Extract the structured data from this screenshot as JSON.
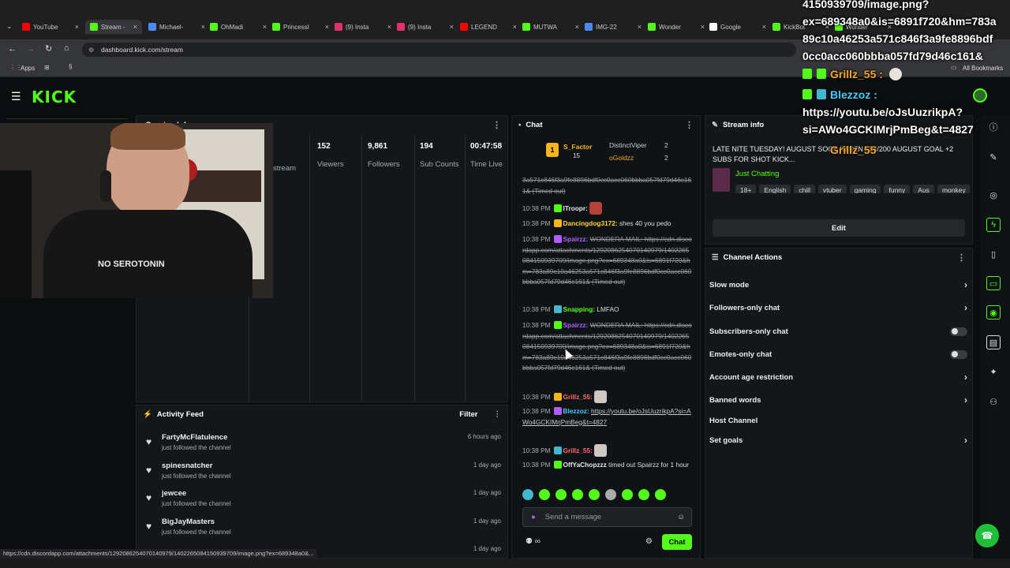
{
  "browser": {
    "tabs": [
      {
        "label": "YouTube",
        "icon": "youtube-icon",
        "color": "#ff0000"
      },
      {
        "label": "Stream -",
        "icon": "kick-icon",
        "color": "#53fc18",
        "active": true
      },
      {
        "label": "Michael-",
        "icon": "image-icon",
        "color": "#4a8af4"
      },
      {
        "label": "OhMadi",
        "icon": "kick-icon",
        "color": "#53fc18"
      },
      {
        "label": "PrincessI",
        "icon": "kick-icon",
        "color": "#53fc18"
      },
      {
        "label": "(9) Insta",
        "icon": "instagram-icon",
        "color": "#e1306c"
      },
      {
        "label": "(9) Insta",
        "icon": "instagram-icon",
        "color": "#e1306c"
      },
      {
        "label": "LEGEND",
        "icon": "youtube-icon",
        "color": "#ff0000"
      },
      {
        "label": "MUTWA",
        "icon": "kick-icon",
        "color": "#53fc18"
      },
      {
        "label": "IMG-22",
        "icon": "image-icon",
        "color": "#4a8af4"
      },
      {
        "label": "Wonder",
        "icon": "kick-icon",
        "color": "#53fc18"
      },
      {
        "label": "Google",
        "icon": "google-icon",
        "color": "#ffffff"
      },
      {
        "label": "KickBot",
        "icon": "kick-icon",
        "color": "#53fc18"
      },
      {
        "label": "Wonder",
        "icon": "kick-icon",
        "color": "#53fc18"
      }
    ],
    "url": "dashboard.kick.com/stream",
    "bookmarks": {
      "apps": "Apps",
      "all": "All Bookmarks"
    },
    "status_url": "https://cdn.discordapp.com/attachments/1292086254070140979/1402265084150939709/image.png?ex=689348a0&..."
  },
  "stream_panel": {
    "title_partial": "Session Info",
    "cam_shirt_text": "NO SEROTONIN",
    "stats": [
      {
        "value": "152",
        "label": "Viewers"
      },
      {
        "value": "9,861",
        "label": "Followers"
      },
      {
        "value": "194",
        "label": "Sub Counts"
      },
      {
        "value": "00:47:58",
        "label": "Time Live"
      }
    ],
    "partial_label": "stream"
  },
  "activity": {
    "title": "Activity Feed",
    "filter": "Filter",
    "items": [
      {
        "name": "FartyMcFlatulence",
        "action": "just followed the channel",
        "ago": "6 hours ago"
      },
      {
        "name": "spinesnatcher",
        "action": "just followed the channel",
        "ago": "1 day ago"
      },
      {
        "name": "jewcee",
        "action": "just followed the channel",
        "ago": "1 day ago"
      },
      {
        "name": "BigJayMasters",
        "action": "just followed the channel",
        "ago": "1 day ago"
      },
      {
        "name": "",
        "action": "",
        "ago": "1 day ago"
      }
    ]
  },
  "chat": {
    "title": "Chat",
    "leaders": {
      "top": {
        "name": "S_Factor",
        "count": "15"
      },
      "second": {
        "name": "DistinctViper",
        "count": "2"
      },
      "third": {
        "name": "oGoldzz",
        "count": "2"
      }
    },
    "input_placeholder": "Send a message",
    "send_label": "Chat",
    "messages": [
      {
        "time": "",
        "user": "",
        "text": "3a571c846f3a9fe8896bdf0cc0acc060bbba057fd79d46c161& (Timed out)"
      },
      {
        "time": "10:38 PM",
        "user": "ITroopr:",
        "color": "#e6e6e6",
        "text": ""
      },
      {
        "time": "10:38 PM",
        "user": "Dancingdog3172:",
        "color": "#ffd23a",
        "text": "shes 40 you pedo"
      },
      {
        "time": "10:38 PM",
        "user": "Spairzz:",
        "color": "#b45cff",
        "text": "WONDERA MAIL: https://cdn.discordapp.com/attachments/1292086254070140979/1402265084150939709/image.png?ex=689348a0&is=6891f720&hm=783a89c10a46253a571c846f3a9fe8896bdf0cc0acc060bbba057fd79d46c161& (Timed out)"
      },
      {
        "time": "10:38 PM",
        "user": "Snapping:",
        "color": "#53fc18",
        "text": "LMFAO"
      },
      {
        "time": "10:38 PM",
        "user": "Spairzz:",
        "color": "#b45cff",
        "text": "WONDERA MAIL: https://cdn.discordapp.com/attachments/1292086254070140979/1402265084150939709/image.png?ex=689348a0&is=6891f720&hm=783a89c10a46253a571c846f3a9fe8896bdf0cc0acc060bbba057fd79d46c161& (Timed out)"
      },
      {
        "time": "10:38 PM",
        "user": "Grillz_55:",
        "color": "#ff6b6b",
        "text": ""
      },
      {
        "time": "10:38 PM",
        "user": "Blezzoz:",
        "color": "#3fd0ff",
        "text": "https://youtu.be/oJsUuzrikpA?si=AWo4GCKIMrjPmBeg&t=4827"
      },
      {
        "time": "10:38 PM",
        "user": "Grillz_55:",
        "color": "#ff6b6b",
        "text": ""
      },
      {
        "time": "10:38 PM",
        "user": "OffYaChopzzz",
        "color": "#e6e6e6",
        "text": "timed out Spairzz for 1 hour"
      }
    ]
  },
  "stream_info": {
    "title": "Stream info",
    "stream_title": "LATE NITE TUESDAY! AUGUST SOCK IN SZN 194/200 AUGUST GOAL +2 SUBS FOR SHOT KICK...",
    "category": "Just Chatting",
    "tags": [
      "18+",
      "English",
      "chill",
      "vtuber",
      "gaming",
      "funny",
      "Aus",
      "monkey"
    ],
    "edit_label": "Edit"
  },
  "channel_actions": {
    "title": "Channel Actions",
    "items": [
      {
        "label": "Slow mode",
        "control": "chevron"
      },
      {
        "label": "Followers-only chat",
        "control": "chevron"
      },
      {
        "label": "Subscribers-only chat",
        "control": "toggle"
      },
      {
        "label": "Emotes-only chat",
        "control": "toggle"
      },
      {
        "label": "Account age restriction",
        "control": "chevron"
      },
      {
        "label": "Banned words",
        "control": "chevron"
      },
      {
        "label": "Host Channel",
        "control": "none"
      },
      {
        "label": "Set goals",
        "control": "chevron"
      }
    ]
  },
  "overlay": {
    "lines": [
      "4150939709/image.png?",
      "ex=689348a0&is=6891f720&hm=783a",
      "89c10a46253a571c846f3a9fe8896bdf",
      "0cc0acc060bbba057fd79d46c161&"
    ],
    "grillz": "Grillz_55 :",
    "blezzoz": "Blezzoz :",
    "blezzoz_link1": "https://youtu.be/oJsUuzrikpA?",
    "blezzoz_link2": "si=AWo4GCKIMrjPmBeg&t=4827",
    "grillz2": "Grillz_55"
  },
  "colors": {
    "accent": "#53fc18",
    "panel": "#141719",
    "bg": "#0b0e0f"
  }
}
